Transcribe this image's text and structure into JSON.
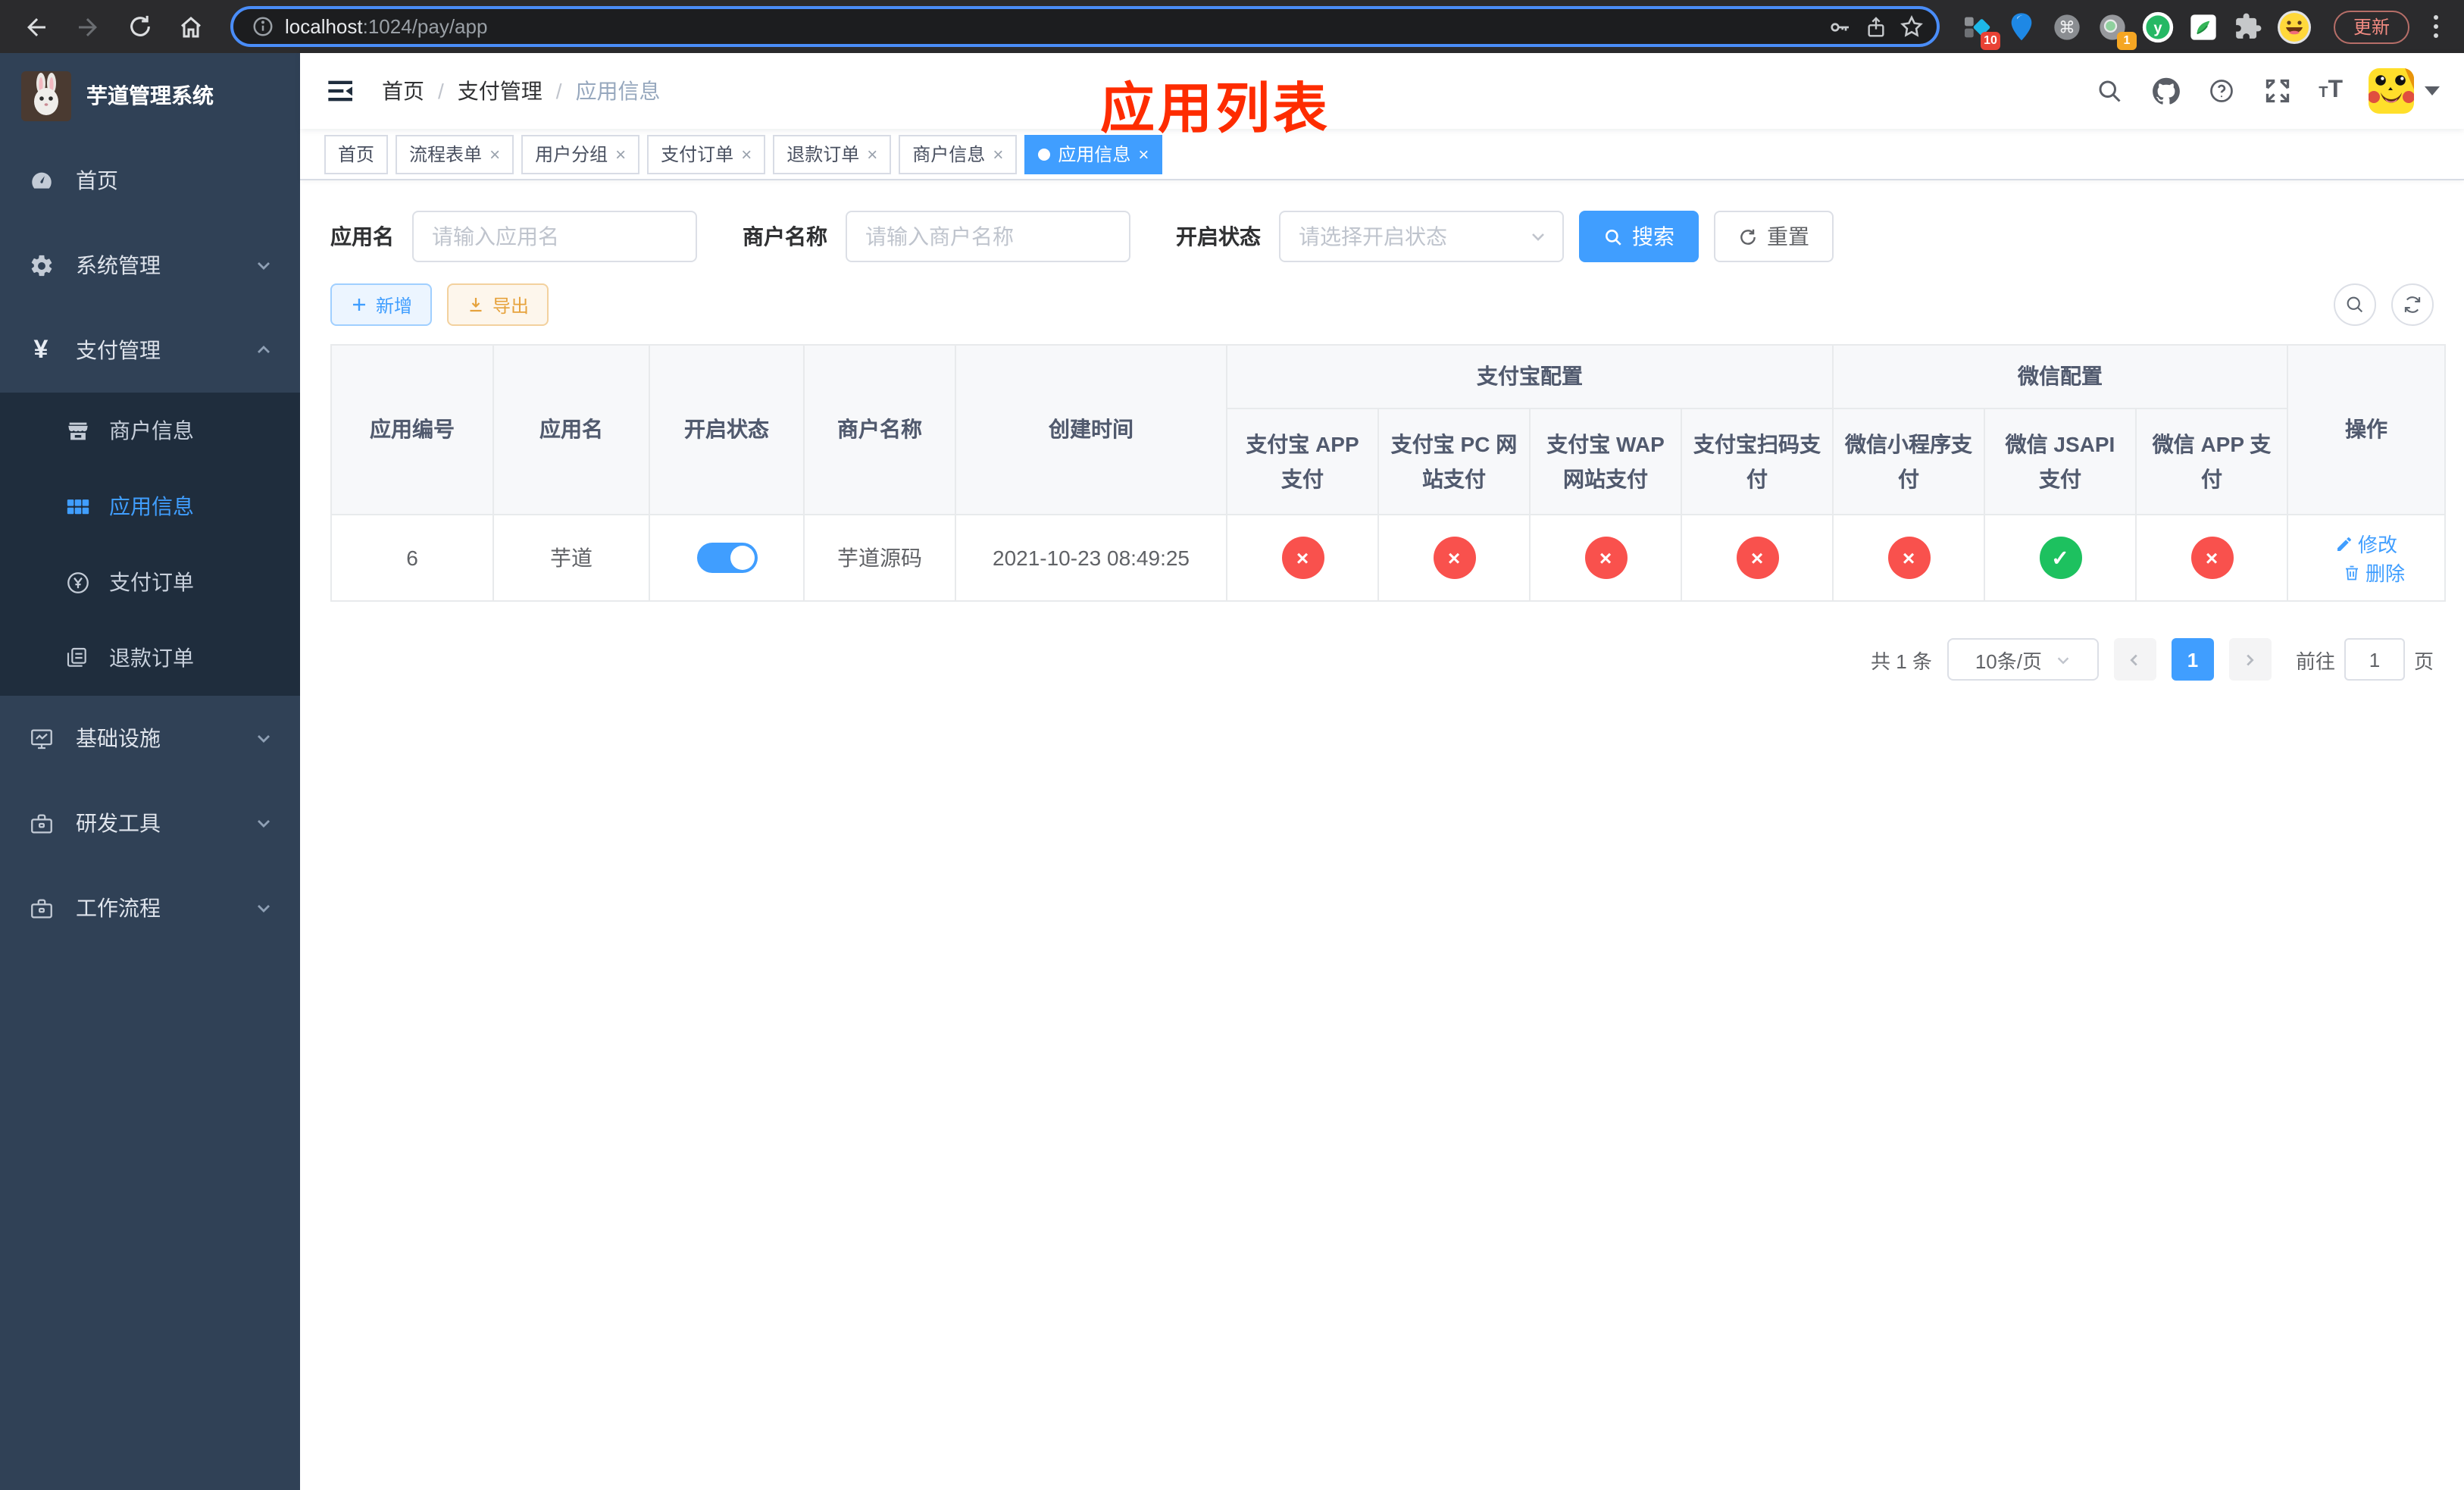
{
  "browser": {
    "url": {
      "host": "localhost",
      "path": ":1024/pay/app"
    },
    "update_button": "更新",
    "ext_badge_a": "10",
    "ext_badge_b": "1"
  },
  "sidebar": {
    "title": "芋道管理系统",
    "menu": [
      {
        "label": "首页"
      },
      {
        "label": "系统管理"
      },
      {
        "label": "支付管理"
      }
    ],
    "submenu": [
      {
        "label": "商户信息"
      },
      {
        "label": "应用信息"
      },
      {
        "label": "支付订单"
      },
      {
        "label": "退款订单"
      }
    ],
    "menu_bottom": [
      {
        "label": "基础设施"
      },
      {
        "label": "研发工具"
      },
      {
        "label": "工作流程"
      }
    ]
  },
  "navbar": {
    "breadcrumb": [
      "首页",
      "支付管理",
      "应用信息"
    ],
    "annotation": "应用列表"
  },
  "tabs": [
    {
      "label": "首页"
    },
    {
      "label": "流程表单"
    },
    {
      "label": "用户分组"
    },
    {
      "label": "支付订单"
    },
    {
      "label": "退款订单"
    },
    {
      "label": "商户信息"
    },
    {
      "label": "应用信息"
    }
  ],
  "filters": {
    "app_name_label": "应用名",
    "app_name_placeholder": "请输入应用名",
    "merchant_label": "商户名称",
    "merchant_placeholder": "请输入商户名称",
    "status_label": "开启状态",
    "status_placeholder": "请选择开启状态",
    "search_button": "搜索",
    "reset_button": "重置"
  },
  "actions": {
    "add_button": "新增",
    "export_button": "导出"
  },
  "table": {
    "columns": {
      "app_id": "应用编号",
      "app_name": "应用名",
      "enabled": "开启状态",
      "merchant": "商户名称",
      "create_time": "创建时间",
      "operation": "操作"
    },
    "groups": {
      "alipay": "支付宝配置",
      "wechat": "微信配置"
    },
    "channel_columns": [
      "支付宝 APP 支付",
      "支付宝 PC 网站支付",
      "支付宝 WAP 网站支付",
      "支付宝扫码支付",
      "微信小程序支付",
      "微信 JSAPI 支付",
      "微信 APP 支付"
    ],
    "row": {
      "app_id": "6",
      "app_name": "芋道",
      "enabled": true,
      "merchant": "芋道源码",
      "create_time": "2021-10-23 08:49:25",
      "channels": [
        false,
        false,
        false,
        false,
        false,
        true,
        false
      ],
      "edit": "修改",
      "delete": "删除"
    }
  },
  "pagination": {
    "total": "共 1 条",
    "page_size": "10条/页",
    "current_page": "1",
    "jump_prefix": "前往",
    "jump_value": "1",
    "jump_suffix": "页"
  },
  "colors": {
    "accent": "#409eff",
    "danger": "#f9514d",
    "success": "#1dc15f",
    "annotation": "#fe2c00",
    "sidebar_bg": "#304156",
    "submenu_bg": "#1f2d3d"
  }
}
